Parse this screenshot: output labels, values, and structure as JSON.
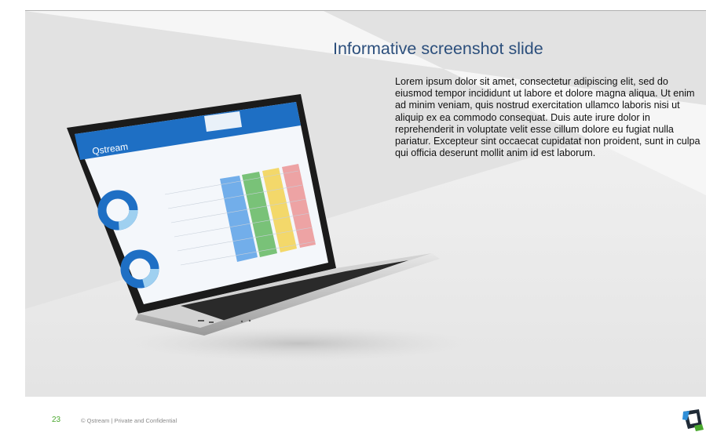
{
  "slide": {
    "title": "Informative screenshot slide",
    "body": "Lorem ipsum dolor sit amet, consectetur adipiscing elit, sed do eiusmod tempor incididunt ut labore et dolore magna aliqua. Ut enim ad minim veniam, quis nostrud exercitation ullamco laboris nisi ut aliquip ex ea commodo consequat. Duis aute irure dolor in reprehenderit in voluptate velit esse cillum dolore eu fugiat nulla pariatur. Excepteur sint occaecat cupidatat non proident, sunt in culpa qui officia deserunt mollit anim id est laborum."
  },
  "laptop_screen": {
    "brand": "Qstream"
  },
  "footer": {
    "page_number": "23",
    "text": "© Qstream | Private and Confidential"
  },
  "colors": {
    "title": "#2c4f7c",
    "page_number": "#4aa82e",
    "brand_blue": "#1e6fc4",
    "cell_green": "#63b860",
    "cell_yellow": "#f2d250",
    "cell_red": "#e86a6a"
  },
  "icons": {
    "logo": "qstream-logo-icon"
  }
}
